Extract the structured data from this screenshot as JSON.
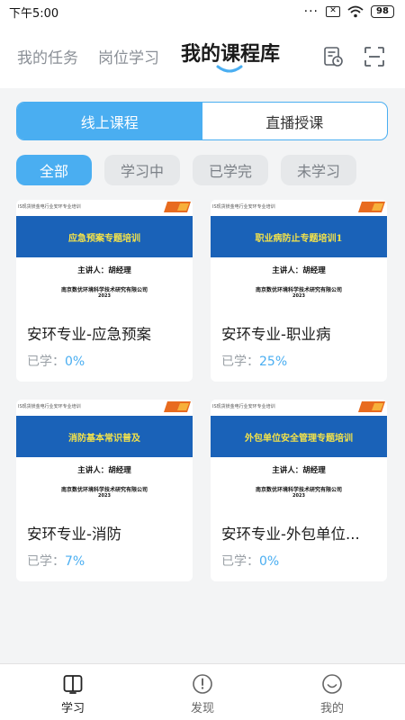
{
  "status_bar": {
    "time": "下午5:00",
    "dots": "···",
    "battery": "98"
  },
  "header": {
    "tabs": [
      {
        "label": "我的任务"
      },
      {
        "label": "岗位学习"
      },
      {
        "label": "我的课程库"
      }
    ],
    "active_tab": "我的课程库",
    "icons": [
      "study-record-icon",
      "scan-icon"
    ]
  },
  "segment": {
    "online": "线上课程",
    "live": "直播授课",
    "selected": "线上课程"
  },
  "filters": [
    {
      "label": "全部"
    },
    {
      "label": "学习中"
    },
    {
      "label": "已学完"
    },
    {
      "label": "未学习"
    }
  ],
  "selected_filter": "全部",
  "courses": [
    {
      "thumb_header": "IS现货镁金电行业安环专业培训",
      "thumb_banner": "应急预案专题培训",
      "thumb_lecturer": "主讲人：胡经理",
      "thumb_org": "南京数优环境科学技术研究有限公司",
      "thumb_year": "2023",
      "title": "安环专业-应急预案",
      "progress_label": "已学：",
      "progress": "0%"
    },
    {
      "thumb_header": "IS现货镁金电行业安环专业培训",
      "thumb_banner": "职业病防止专题培训1",
      "thumb_lecturer": "主讲人：胡经理",
      "thumb_org": "南京数优环境科学技术研究有限公司",
      "thumb_year": "2023",
      "title": "安环专业-职业病",
      "progress_label": "已学：",
      "progress": "25%"
    },
    {
      "thumb_header": "IS现货镁金电行业安环专业培训",
      "thumb_banner": "消防基本常识普及",
      "thumb_lecturer": "主讲人：胡经理",
      "thumb_org": "南京数优环境科学技术研究有限公司",
      "thumb_year": "2023",
      "title": "安环专业-消防",
      "progress_label": "已学：",
      "progress": "7%"
    },
    {
      "thumb_header": "IS现货镁金电行业安环专业培训",
      "thumb_banner": "外包单位安全管理专题培训",
      "thumb_lecturer": "主讲人：胡经理",
      "thumb_org": "南京数优环境科学技术研究有限公司",
      "thumb_year": "2023",
      "title": "安环专业-外包单位...",
      "progress_label": "已学：",
      "progress": "0%"
    }
  ],
  "bottom_nav": [
    {
      "label": "学习",
      "icon": "book-icon"
    },
    {
      "label": "发现",
      "icon": "compass-icon"
    },
    {
      "label": "我的",
      "icon": "smile-icon"
    }
  ],
  "active_bottom": "学习",
  "colors": {
    "accent": "#4aaef1",
    "banner": "#1a62b8",
    "banner_text": "#f3e24a",
    "background": "#f3f4f5"
  }
}
